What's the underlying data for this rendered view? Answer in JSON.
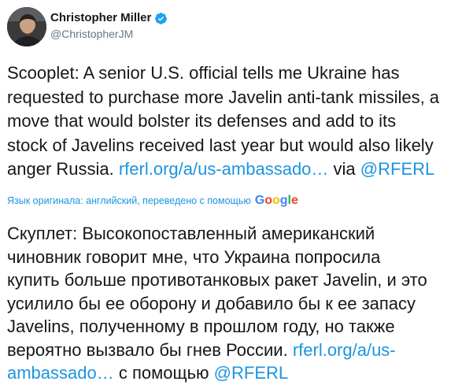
{
  "author": {
    "display_name": "Christopher Miller",
    "handle": "@ChristopherJM",
    "verified": true
  },
  "tweet": {
    "lines": [
      "Scooplet: A senior U.S. official tells me Ukraine has",
      "requested to purchase more Javelin anti-tank missiles, a",
      "move that would bolster its defenses and add to its",
      "stock of Javelins received last year but would also likely",
      "anger Russia. "
    ],
    "link_text": "rferl.org/a/us-ambassado…",
    "via_text": " via ",
    "mention": "@RFERL"
  },
  "translation": {
    "label": "Язык оригинала: английский, переведено с помощью",
    "provider": "Google",
    "lines": [
      "Скуплет: Высокопоставленный американский",
      "чиновник говорит мне, что Украина попросила",
      "купить больше противотанковых ракет Javelin, и это",
      "усилило бы ее оборону и добавило бы к ее запасу",
      "Javelins, полученному в прошлом году, но также",
      "вероятно вызвало бы гнев России. "
    ],
    "link_part1": "rferl.org/a/us-",
    "link_part2": "ambassado…",
    "via_text": " с помощью ",
    "mention": "@RFERL"
  },
  "colors": {
    "link": "#1b95e0",
    "text": "#14171a",
    "secondary": "#657786",
    "verified": "#1da1f2"
  },
  "icons": {
    "verified": "verified-badge-icon"
  }
}
